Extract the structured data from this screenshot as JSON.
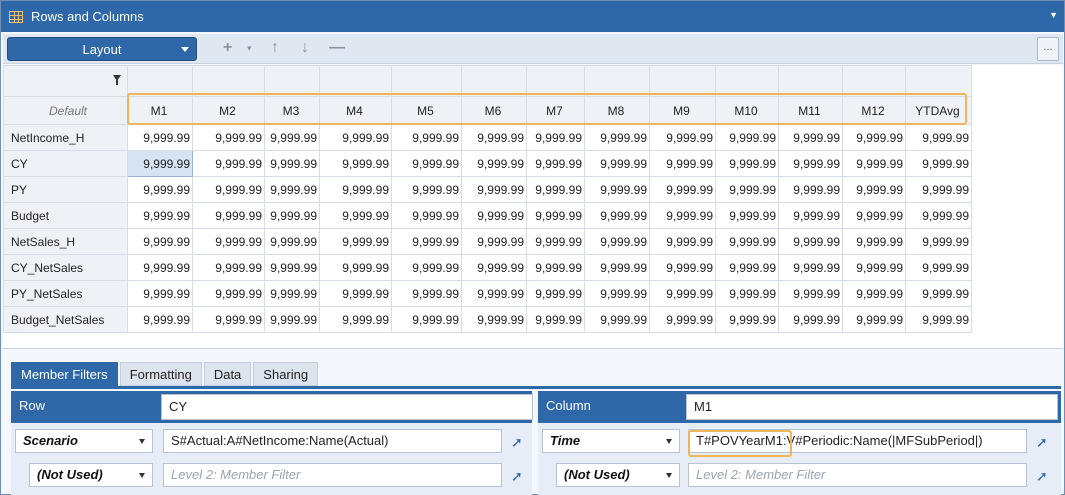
{
  "window": {
    "title": "Rows and Columns"
  },
  "toolbar": {
    "layout_label": "Layout",
    "more_label": "..."
  },
  "grid": {
    "default_label": "Default",
    "columns": [
      "M1",
      "M2",
      "M3",
      "M4",
      "M5",
      "M6",
      "M7",
      "M8",
      "M9",
      "M10",
      "M11",
      "M12",
      "YTDAvg"
    ],
    "rows": [
      {
        "label": "NetIncome_H",
        "cells": [
          "9,999.99",
          "9,999.99",
          "9,999.99",
          "9,999.99",
          "9,999.99",
          "9,999.99",
          "9,999.99",
          "9,999.99",
          "9,999.99",
          "9,999.99",
          "9,999.99",
          "9,999.99",
          "9,999.99"
        ]
      },
      {
        "label": "CY",
        "cells": [
          "9,999.99",
          "9,999.99",
          "9,999.99",
          "9,999.99",
          "9,999.99",
          "9,999.99",
          "9,999.99",
          "9,999.99",
          "9,999.99",
          "9,999.99",
          "9,999.99",
          "9,999.99",
          "9,999.99"
        ]
      },
      {
        "label": "PY",
        "cells": [
          "9,999.99",
          "9,999.99",
          "9,999.99",
          "9,999.99",
          "9,999.99",
          "9,999.99",
          "9,999.99",
          "9,999.99",
          "9,999.99",
          "9,999.99",
          "9,999.99",
          "9,999.99",
          "9,999.99"
        ]
      },
      {
        "label": "Budget",
        "cells": [
          "9,999.99",
          "9,999.99",
          "9,999.99",
          "9,999.99",
          "9,999.99",
          "9,999.99",
          "9,999.99",
          "9,999.99",
          "9,999.99",
          "9,999.99",
          "9,999.99",
          "9,999.99",
          "9,999.99"
        ]
      },
      {
        "label": "NetSales_H",
        "cells": [
          "9,999.99",
          "9,999.99",
          "9,999.99",
          "9,999.99",
          "9,999.99",
          "9,999.99",
          "9,999.99",
          "9,999.99",
          "9,999.99",
          "9,999.99",
          "9,999.99",
          "9,999.99",
          "9,999.99"
        ]
      },
      {
        "label": "CY_NetSales",
        "cells": [
          "9,999.99",
          "9,999.99",
          "9,999.99",
          "9,999.99",
          "9,999.99",
          "9,999.99",
          "9,999.99",
          "9,999.99",
          "9,999.99",
          "9,999.99",
          "9,999.99",
          "9,999.99",
          "9,999.99"
        ]
      },
      {
        "label": "PY_NetSales",
        "cells": [
          "9,999.99",
          "9,999.99",
          "9,999.99",
          "9,999.99",
          "9,999.99",
          "9,999.99",
          "9,999.99",
          "9,999.99",
          "9,999.99",
          "9,999.99",
          "9,999.99",
          "9,999.99",
          "9,999.99"
        ]
      },
      {
        "label": "Budget_NetSales",
        "cells": [
          "9,999.99",
          "9,999.99",
          "9,999.99",
          "9,999.99",
          "9,999.99",
          "9,999.99",
          "9,999.99",
          "9,999.99",
          "9,999.99",
          "9,999.99",
          "9,999.99",
          "9,999.99",
          "9,999.99"
        ]
      }
    ]
  },
  "tabs": [
    "Member Filters",
    "Formatting",
    "Data",
    "Sharing"
  ],
  "row_panel": {
    "label": "Row",
    "name_value": "CY",
    "dim1": "Scenario",
    "filter1": "S#Actual:A#NetIncome:Name(Actual)",
    "dim2": "(Not Used)",
    "filter2_placeholder": "Level 2: Member Filter"
  },
  "column_panel": {
    "label": "Column",
    "name_value": "M1",
    "dim1": "Time",
    "filter1": "T#POVYearM1:V#Periodic:Name(|MFSubPeriod|)",
    "dim2": "(Not Used)",
    "filter2_placeholder": "Level 2: Member Filter"
  },
  "colors": {
    "accent": "#2e68a8",
    "highlight": "#f0b45a"
  }
}
